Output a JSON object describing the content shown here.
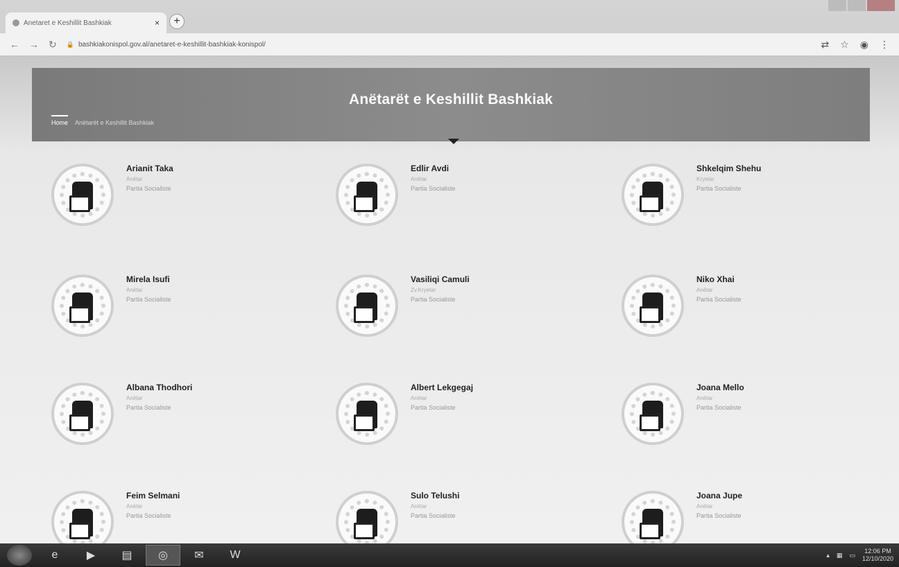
{
  "browser": {
    "tab_title": "Anetaret e Keshillit Bashkiak",
    "tab_close": "×",
    "new_tab": "+",
    "url": "bashkiakonispol.gov.al/anetaret-e-keshillit-bashkiak-konispol/"
  },
  "hero": {
    "title": "Anëtarët e Keshillit Bashkiak",
    "breadcrumb_home": "Home",
    "breadcrumb_current": "Anëtarët e Keshillit Bashkiak"
  },
  "members": [
    {
      "name": "Arianit Taka",
      "role": "Anëtar",
      "party": "Partia Socialiste"
    },
    {
      "name": "Edlir Avdi",
      "role": "Anëtar",
      "party": "Partia Socialiste"
    },
    {
      "name": "Shkelqim Shehu",
      "role": "Kryetar",
      "party": "Partia Socialiste"
    },
    {
      "name": "Mirela Isufi",
      "role": "Anëtar",
      "party": "Partia Socialiste"
    },
    {
      "name": "Vasiliqi Camuli",
      "role": "Zv.Kryetar",
      "party": "Partia Socialiste"
    },
    {
      "name": "Niko Xhai",
      "role": "Anëtar",
      "party": "Partia Socialiste"
    },
    {
      "name": "Albana Thodhori",
      "role": "Anëtar",
      "party": "Partia Socialiste"
    },
    {
      "name": "Albert Lekgegaj",
      "role": "Anëtar",
      "party": "Partia Socialiste"
    },
    {
      "name": "Joana Mello",
      "role": "Anëtar",
      "party": "Partia Socialiste"
    },
    {
      "name": "Feim Selmani",
      "role": "Anëtar",
      "party": "Partia Socialiste"
    },
    {
      "name": "Sulo Telushi",
      "role": "Anëtar",
      "party": "Partia Socialiste"
    },
    {
      "name": "Joana Jupe",
      "role": "Anëtar",
      "party": "Partia Socialiste"
    }
  ],
  "taskbar": {
    "time": "12:06 PM",
    "date": "12/10/2020"
  }
}
